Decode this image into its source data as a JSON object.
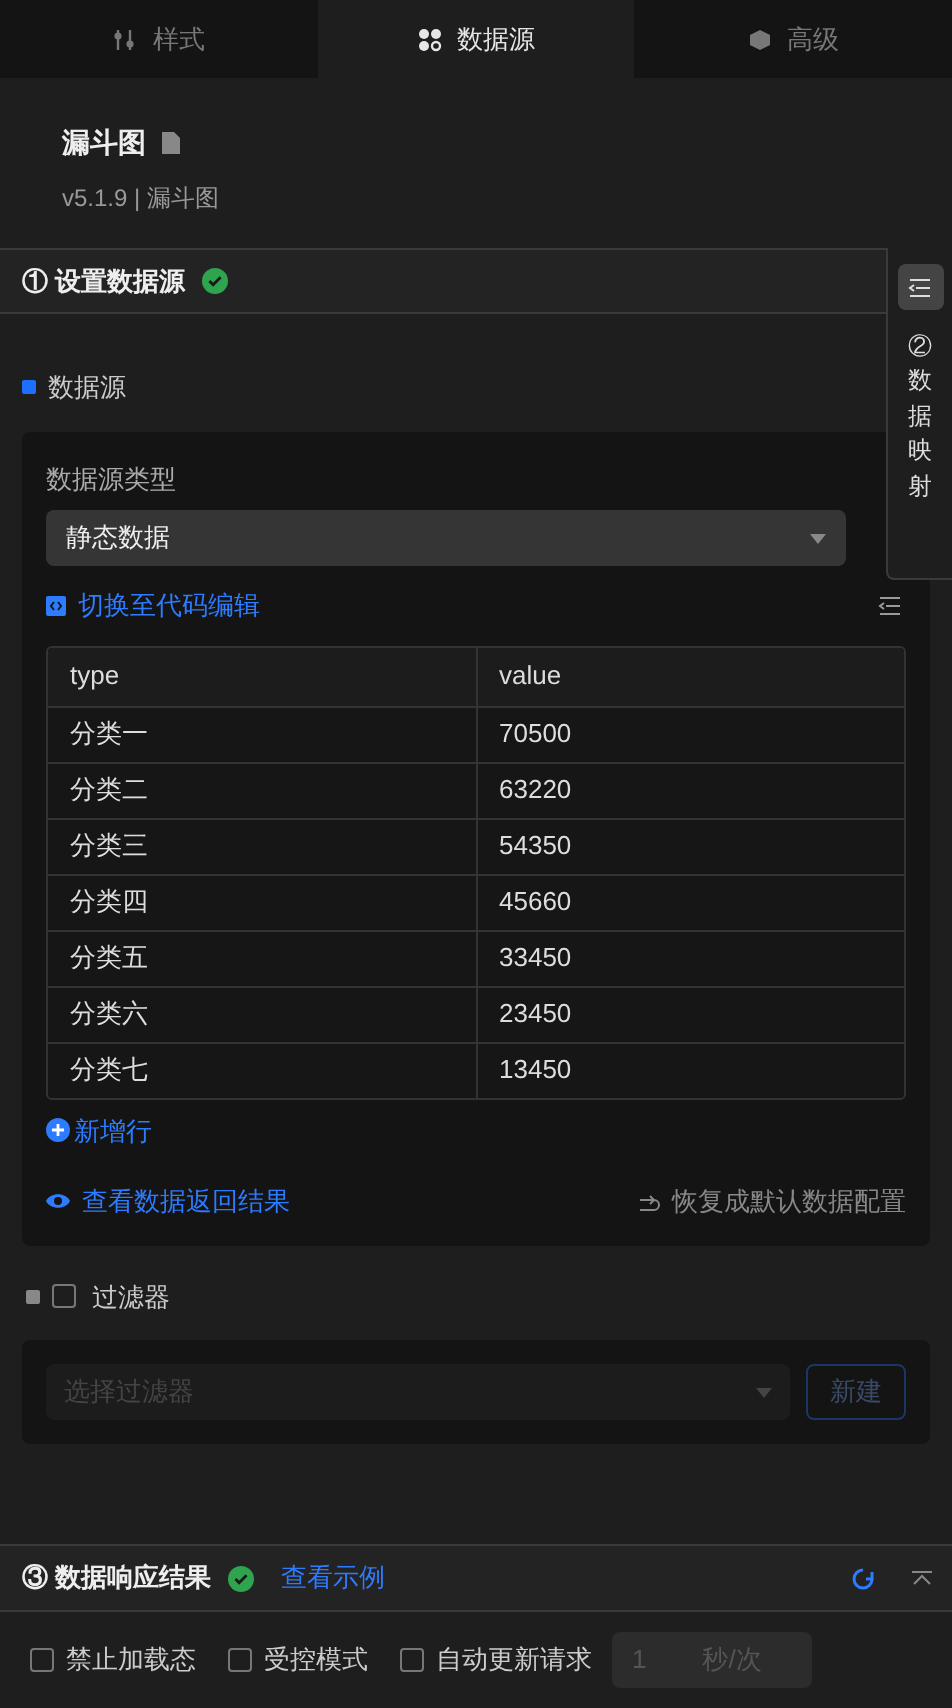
{
  "tabs": [
    {
      "label": "样式",
      "kind": "style",
      "selected": false
    },
    {
      "label": "数据源",
      "kind": "data",
      "selected": true
    },
    {
      "label": "高级",
      "kind": "advanced",
      "selected": false
    }
  ],
  "component": {
    "title": "漏斗图",
    "version": "v5.1.9 | 漏斗图"
  },
  "section_1": {
    "title": "① 设置数据源",
    "done": true
  },
  "side_panel": {
    "label": "②数据映射"
  },
  "data_source": {
    "label": "数据源",
    "type_label": "数据源类型",
    "type_value": "静态数据",
    "code_edit_link": "切换至代码编辑",
    "table": {
      "columns": [
        "type",
        "value"
      ],
      "rows": [
        [
          "分类一",
          "70500"
        ],
        [
          "分类二",
          "63220"
        ],
        [
          "分类三",
          "54350"
        ],
        [
          "分类四",
          "45660"
        ],
        [
          "分类五",
          "33450"
        ],
        [
          "分类六",
          "23450"
        ],
        [
          "分类七",
          "13450"
        ]
      ]
    },
    "add_row": "新增行",
    "view_result": "查看数据返回结果",
    "reset": "恢复成默认数据配置"
  },
  "filter": {
    "label": "过滤器",
    "checked": false,
    "placeholder": "选择过滤器",
    "new_button": "新建"
  },
  "section_3": {
    "title": "③ 数据响应结果",
    "done": true,
    "example_link": "查看示例"
  },
  "options": [
    {
      "label": "禁止加载态",
      "checked": false
    },
    {
      "label": "受控模式",
      "checked": false
    },
    {
      "label": "自动更新请求",
      "checked": false
    }
  ],
  "interval": {
    "value": "1",
    "unit": "秒/次"
  }
}
